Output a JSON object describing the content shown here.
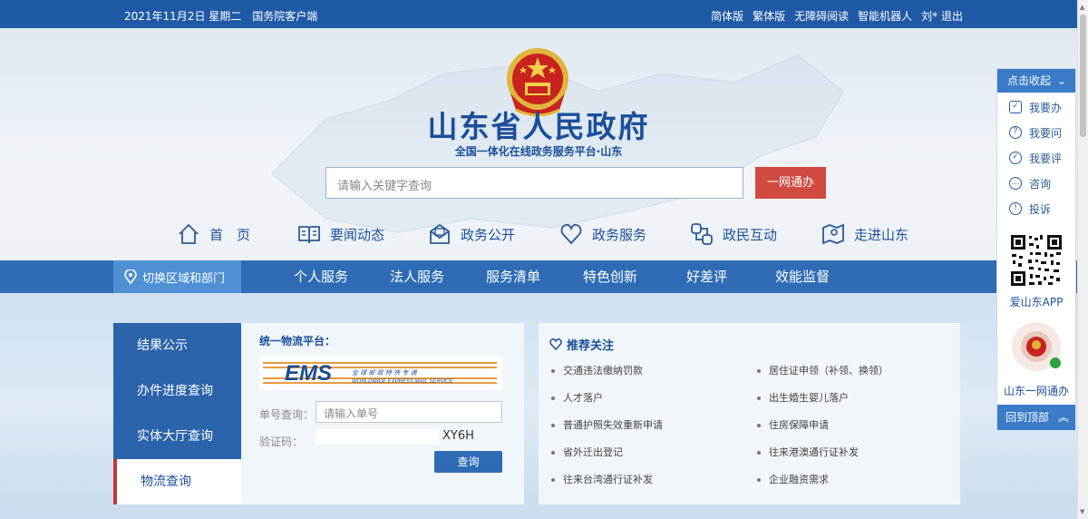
{
  "topbar": {
    "date": "2021年11月2日 星期二",
    "client": "国务院客户端",
    "links": [
      "简体版",
      "繁体版",
      "无障碍阅读",
      "智能机器人",
      "刘* 退出"
    ]
  },
  "site": {
    "title": "山东省人民政府",
    "subtitle": "全国一体化在线政务服务平台·山东"
  },
  "search": {
    "placeholder": "请输入关键字查询",
    "button": "一网通办"
  },
  "nav": [
    {
      "label": "首　页",
      "icon": "home-icon"
    },
    {
      "label": "要闻动态",
      "icon": "book-icon"
    },
    {
      "label": "政务公开",
      "icon": "mail-icon"
    },
    {
      "label": "政务服务",
      "icon": "heart-icon"
    },
    {
      "label": "政民互动",
      "icon": "link-icon"
    },
    {
      "label": "走进山东",
      "icon": "map-pin-icon"
    }
  ],
  "region_button": "切换区域和部门",
  "tabs": [
    "个人服务",
    "法人服务",
    "服务清单",
    "特色创新",
    "好差评",
    "效能监督"
  ],
  "side_menu": [
    "结果公示",
    "办件进度查询",
    "实体大厅查询",
    "物流查询"
  ],
  "logistics": {
    "title": "统一物流平台：",
    "ems_brand": "EMS",
    "ems_cn": "全 球 邮 政 特 快 专 递",
    "ems_en": "WORLDWIDE EXPRESS MAIL SERVICE",
    "order_label": "单号查询：",
    "order_placeholder": "请输入单号",
    "captcha_label": "验证码：",
    "captcha_code": "XY6H",
    "query_button": "查询"
  },
  "recommend": {
    "title": "推荐关注",
    "items": [
      "交通违法缴纳罚款",
      "居住证申领（补领、换领）",
      "人才落户",
      "出生婚生婴儿落户",
      "普通护照失效重新申请",
      "住房保障申请",
      "省外迁出登记",
      "往来港澳通行证补发",
      "往来台湾通行证补发",
      "企业融资需求"
    ]
  },
  "float_panel": {
    "collapse": "点击收起",
    "items": [
      "我要办",
      "我要问",
      "我要评",
      "咨询",
      "投诉"
    ],
    "app_label": "爱山东APP",
    "mini_label": "山东一网通办",
    "back_top": "回到顶部"
  },
  "colors": {
    "primary": "#1f5aa6",
    "accent_red": "#d14a3f",
    "title_blue": "#1b4f9a"
  }
}
